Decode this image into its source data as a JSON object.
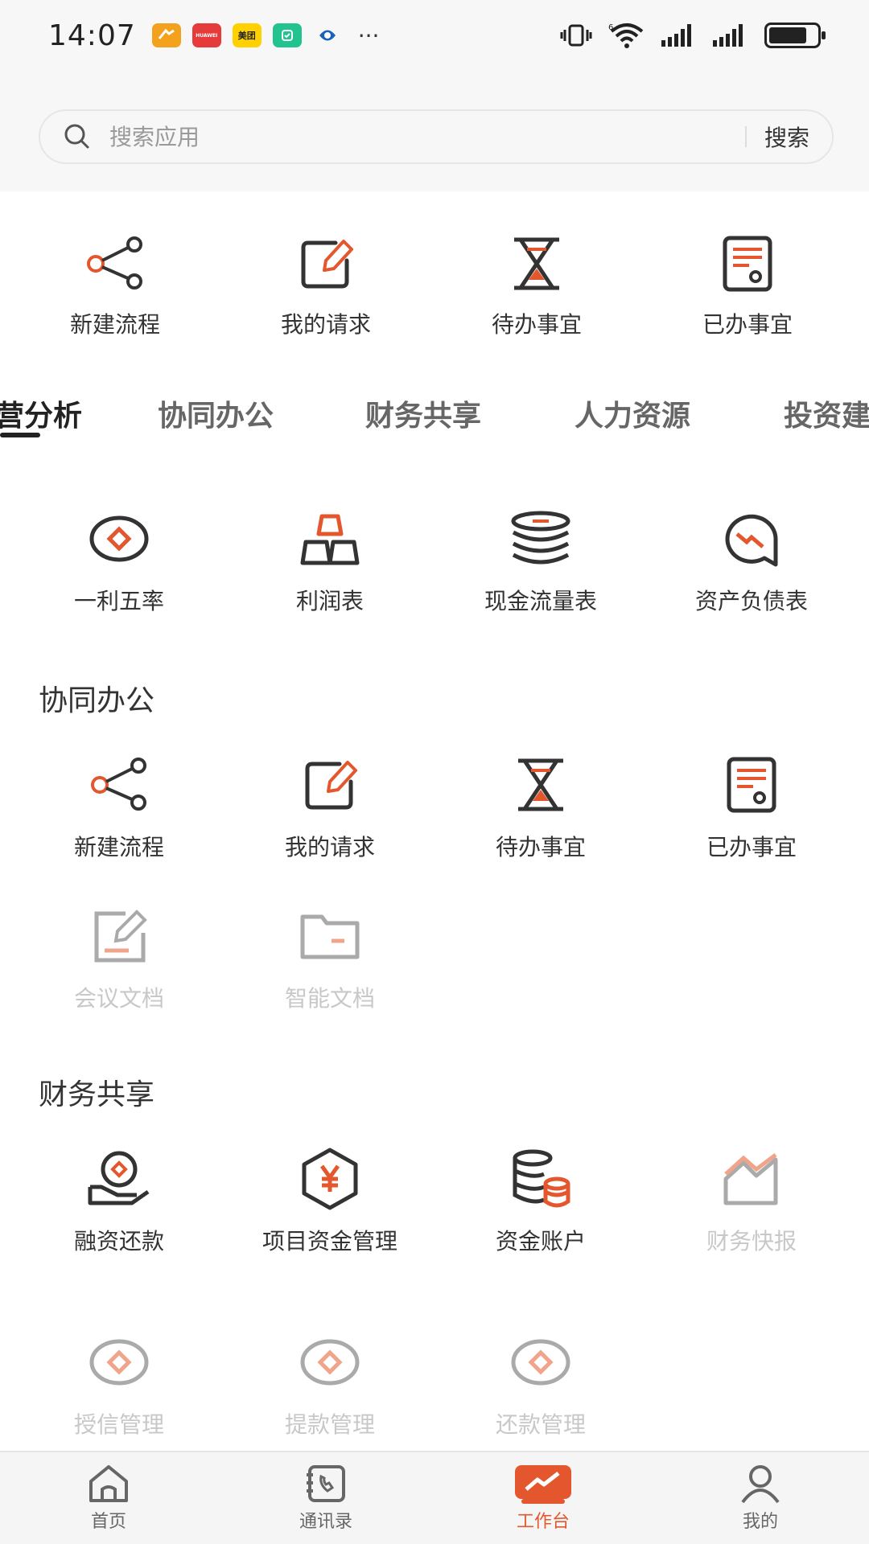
{
  "status_bar": {
    "time": "14:07",
    "apps": [
      {
        "name": "app-icon-1",
        "color": "#f4a21d",
        "text": ""
      },
      {
        "name": "huawei-app-icon",
        "color": "#e53b3b",
        "text": "HUAWEI"
      },
      {
        "name": "meituan-app-icon",
        "color": "#ffd100",
        "text": "美团"
      },
      {
        "name": "app-icon-4",
        "color": "#22c38e",
        "text": ""
      },
      {
        "name": "app-icon-5",
        "color": "#ffffff",
        "text": ""
      }
    ],
    "more": "···",
    "network": "6"
  },
  "search": {
    "placeholder": "搜索应用",
    "button": "搜索"
  },
  "quick": [
    {
      "label": "新建流程",
      "icon": "share-flow-icon"
    },
    {
      "label": "我的请求",
      "icon": "edit-icon"
    },
    {
      "label": "待办事宜",
      "icon": "hourglass-icon"
    },
    {
      "label": "已办事宜",
      "icon": "done-doc-icon"
    }
  ],
  "tabs": [
    {
      "label": "营分析",
      "active": true
    },
    {
      "label": "协同办公"
    },
    {
      "label": "财务共享"
    },
    {
      "label": "人力资源"
    },
    {
      "label": "投资建"
    }
  ],
  "analysis": [
    {
      "label": "一利五率",
      "icon": "diamond-coin-icon"
    },
    {
      "label": "利润表",
      "icon": "gold-bars-icon"
    },
    {
      "label": "现金流量表",
      "icon": "coin-stack-icon"
    },
    {
      "label": "资产负债表",
      "icon": "trend-down-chat-icon"
    }
  ],
  "collab": {
    "title": "协同办公",
    "row1": [
      {
        "label": "新建流程",
        "icon": "share-flow-icon"
      },
      {
        "label": "我的请求",
        "icon": "edit-icon"
      },
      {
        "label": "待办事宜",
        "icon": "hourglass-icon"
      },
      {
        "label": "已办事宜",
        "icon": "done-doc-icon"
      }
    ],
    "row2": [
      {
        "label": "会议文档",
        "icon": "meeting-doc-icon"
      },
      {
        "label": "智能文档",
        "icon": "folder-icon"
      }
    ]
  },
  "finance": {
    "title": "财务共享",
    "row1": [
      {
        "label": "融资还款",
        "icon": "loan-repay-icon"
      },
      {
        "label": "项目资金管理",
        "icon": "yuan-hexagon-icon"
      },
      {
        "label": "资金账户",
        "icon": "fund-account-icon"
      },
      {
        "label": "财务快报",
        "icon": "finance-chart-icon"
      }
    ],
    "row2": [
      {
        "label": "授信管理",
        "icon": "diamond-coin-icon"
      },
      {
        "label": "提款管理",
        "icon": "diamond-coin-icon"
      },
      {
        "label": "还款管理",
        "icon": "diamond-coin-icon"
      }
    ]
  },
  "nav": [
    {
      "label": "首页",
      "icon": "home-icon"
    },
    {
      "label": "通讯录",
      "icon": "contacts-icon"
    },
    {
      "label": "工作台",
      "icon": "workbench-icon",
      "active": true
    },
    {
      "label": "我的",
      "icon": "profile-icon"
    }
  ],
  "colors": {
    "accent": "#e4572e",
    "dark": "#333333",
    "muted": "#c8c8c8"
  }
}
